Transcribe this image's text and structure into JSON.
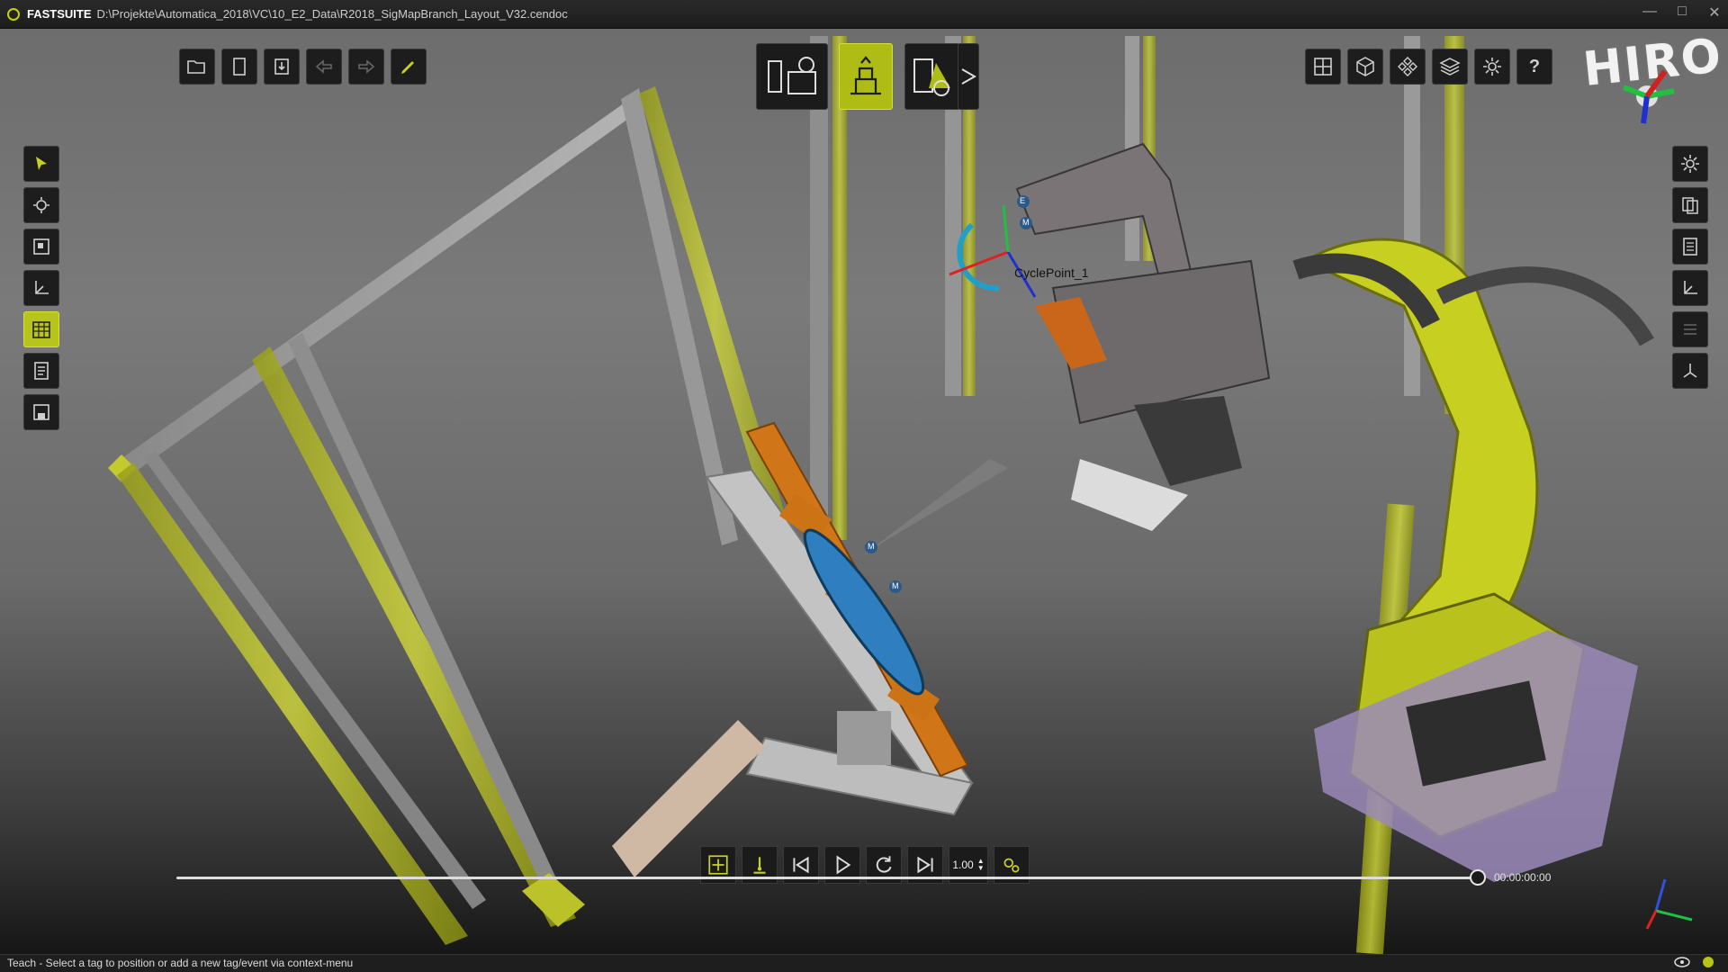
{
  "titlebar": {
    "app_name": "FASTSUITE",
    "path": "D:\\Projekte\\Automatica_2018\\VC\\10_E2_Data\\R2018_SigMapBranch_Layout_V32.cendoc"
  },
  "top_toolbar": {
    "file_icons": [
      "folder-open-icon",
      "new-document-icon",
      "import-icon",
      "undo-icon",
      "redo-icon",
      "pencil-icon"
    ],
    "mode_icons": [
      "layout-mode-icon",
      "robot-teach-mode-icon",
      "shapes-mode-icon",
      "expand-arrow-icon"
    ],
    "view_icons": [
      "layout-grid-icon",
      "cube-view-icon",
      "components-icon",
      "layers-icon",
      "settings-icon",
      "help-icon"
    ],
    "help_label": "?"
  },
  "left_toolbar": {
    "icons": [
      "select-arrow-icon",
      "gear-select-icon",
      "frame-icon",
      "axes-icon",
      "calendar-grid-icon",
      "document-list-icon",
      "save-icon"
    ],
    "active_index": 4
  },
  "right_toolbar": {
    "icons": [
      "settings-icon",
      "copy-icon",
      "document-icon",
      "axes-icon",
      "list-icon",
      "frame-axes-icon"
    ]
  },
  "viewport": {
    "logo_text": "HIRO",
    "point_label": "CyclePoint_1",
    "marker_labels": [
      "E",
      "M",
      "M",
      "M"
    ]
  },
  "playback": {
    "icons": [
      "teach-icon",
      "tag-icon",
      "skip-back-icon",
      "play-icon",
      "loop-icon",
      "skip-forward-icon",
      "speed-field",
      "settings-gears-icon"
    ],
    "speed": "1.00",
    "time": "00:00:00:00",
    "progress": 1.0
  },
  "statusbar": {
    "message": "Teach - Select a tag to position or add a new tag/event via context-menu",
    "icons": [
      "eye-icon",
      "status-dot-icon"
    ]
  },
  "colors": {
    "accent": "#b7c41b",
    "robot_yellow": "#c7cf20",
    "fixture_orange": "#d47a1a",
    "part_blue": "#2f7fc0",
    "base_lavender": "#9a8ab8"
  }
}
